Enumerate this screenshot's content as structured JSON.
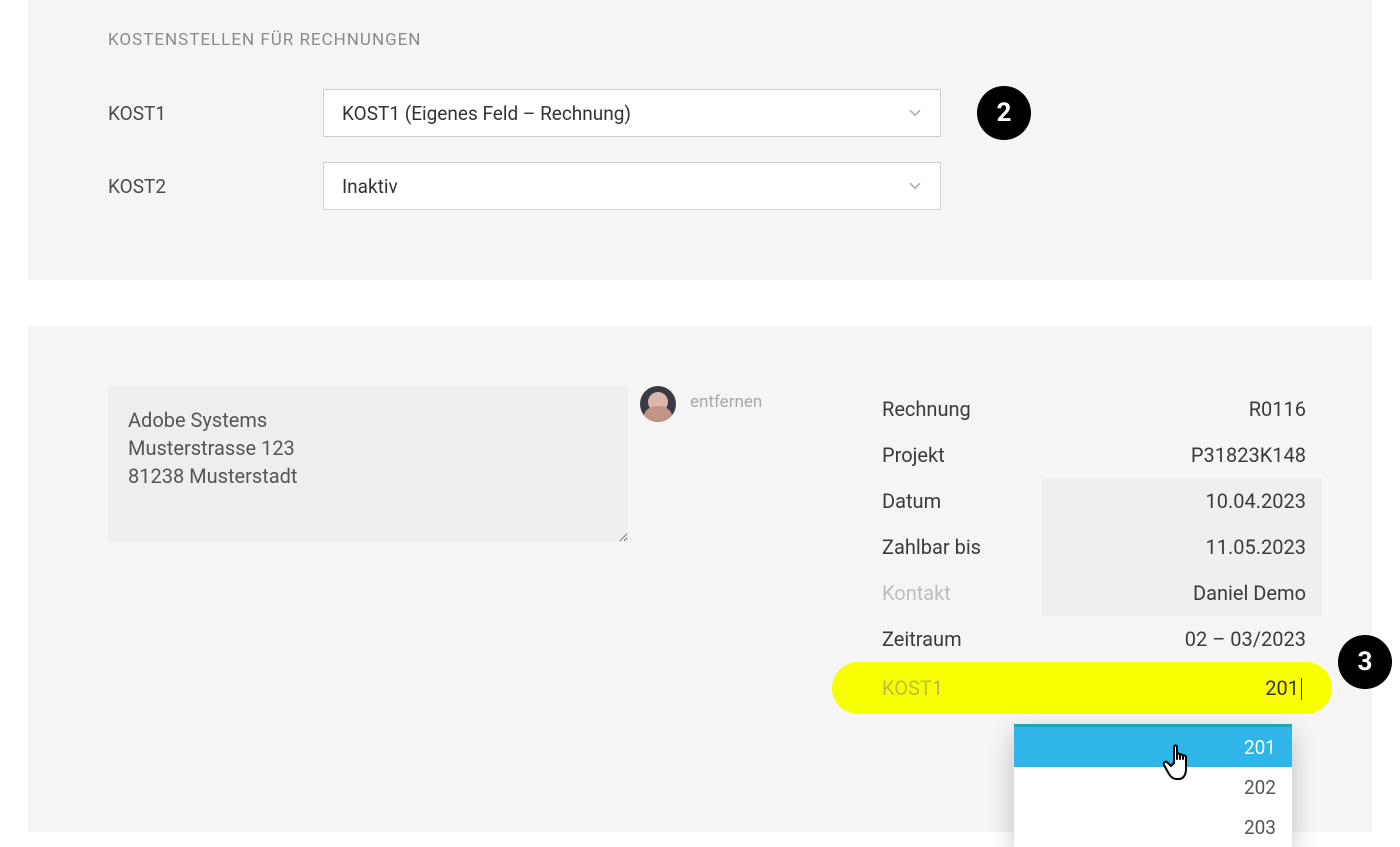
{
  "section_title": "KOSTENSTELLEN FÜR RECHNUNGEN",
  "badges": {
    "two": "2",
    "three": "3"
  },
  "kost1": {
    "label": "KOST1",
    "selected": "KOST1 (Eigenes Feld – Rechnung)"
  },
  "kost2": {
    "label": "KOST2",
    "selected": "Inaktiv"
  },
  "address": "Adobe Systems\nMusterstrasse 123\n81238 Musterstadt",
  "remove_label": "entfernen",
  "meta": {
    "rechnung": {
      "label": "Rechnung",
      "value": "R0116"
    },
    "projekt": {
      "label": "Projekt",
      "value": "P31823K148"
    },
    "datum": {
      "label": "Datum",
      "value": "10.04.2023"
    },
    "zahlbar": {
      "label": "Zahlbar bis",
      "value": "11.05.2023"
    },
    "kontakt": {
      "label": "Kontakt",
      "value": "Daniel Demo"
    },
    "zeitraum": {
      "label": "Zeitraum",
      "value": "02 – 03/2023"
    },
    "kost1": {
      "label": "KOST1",
      "value": "201"
    }
  },
  "dropdown": {
    "options": [
      "201",
      "202",
      "203"
    ],
    "selected_index": 0
  }
}
